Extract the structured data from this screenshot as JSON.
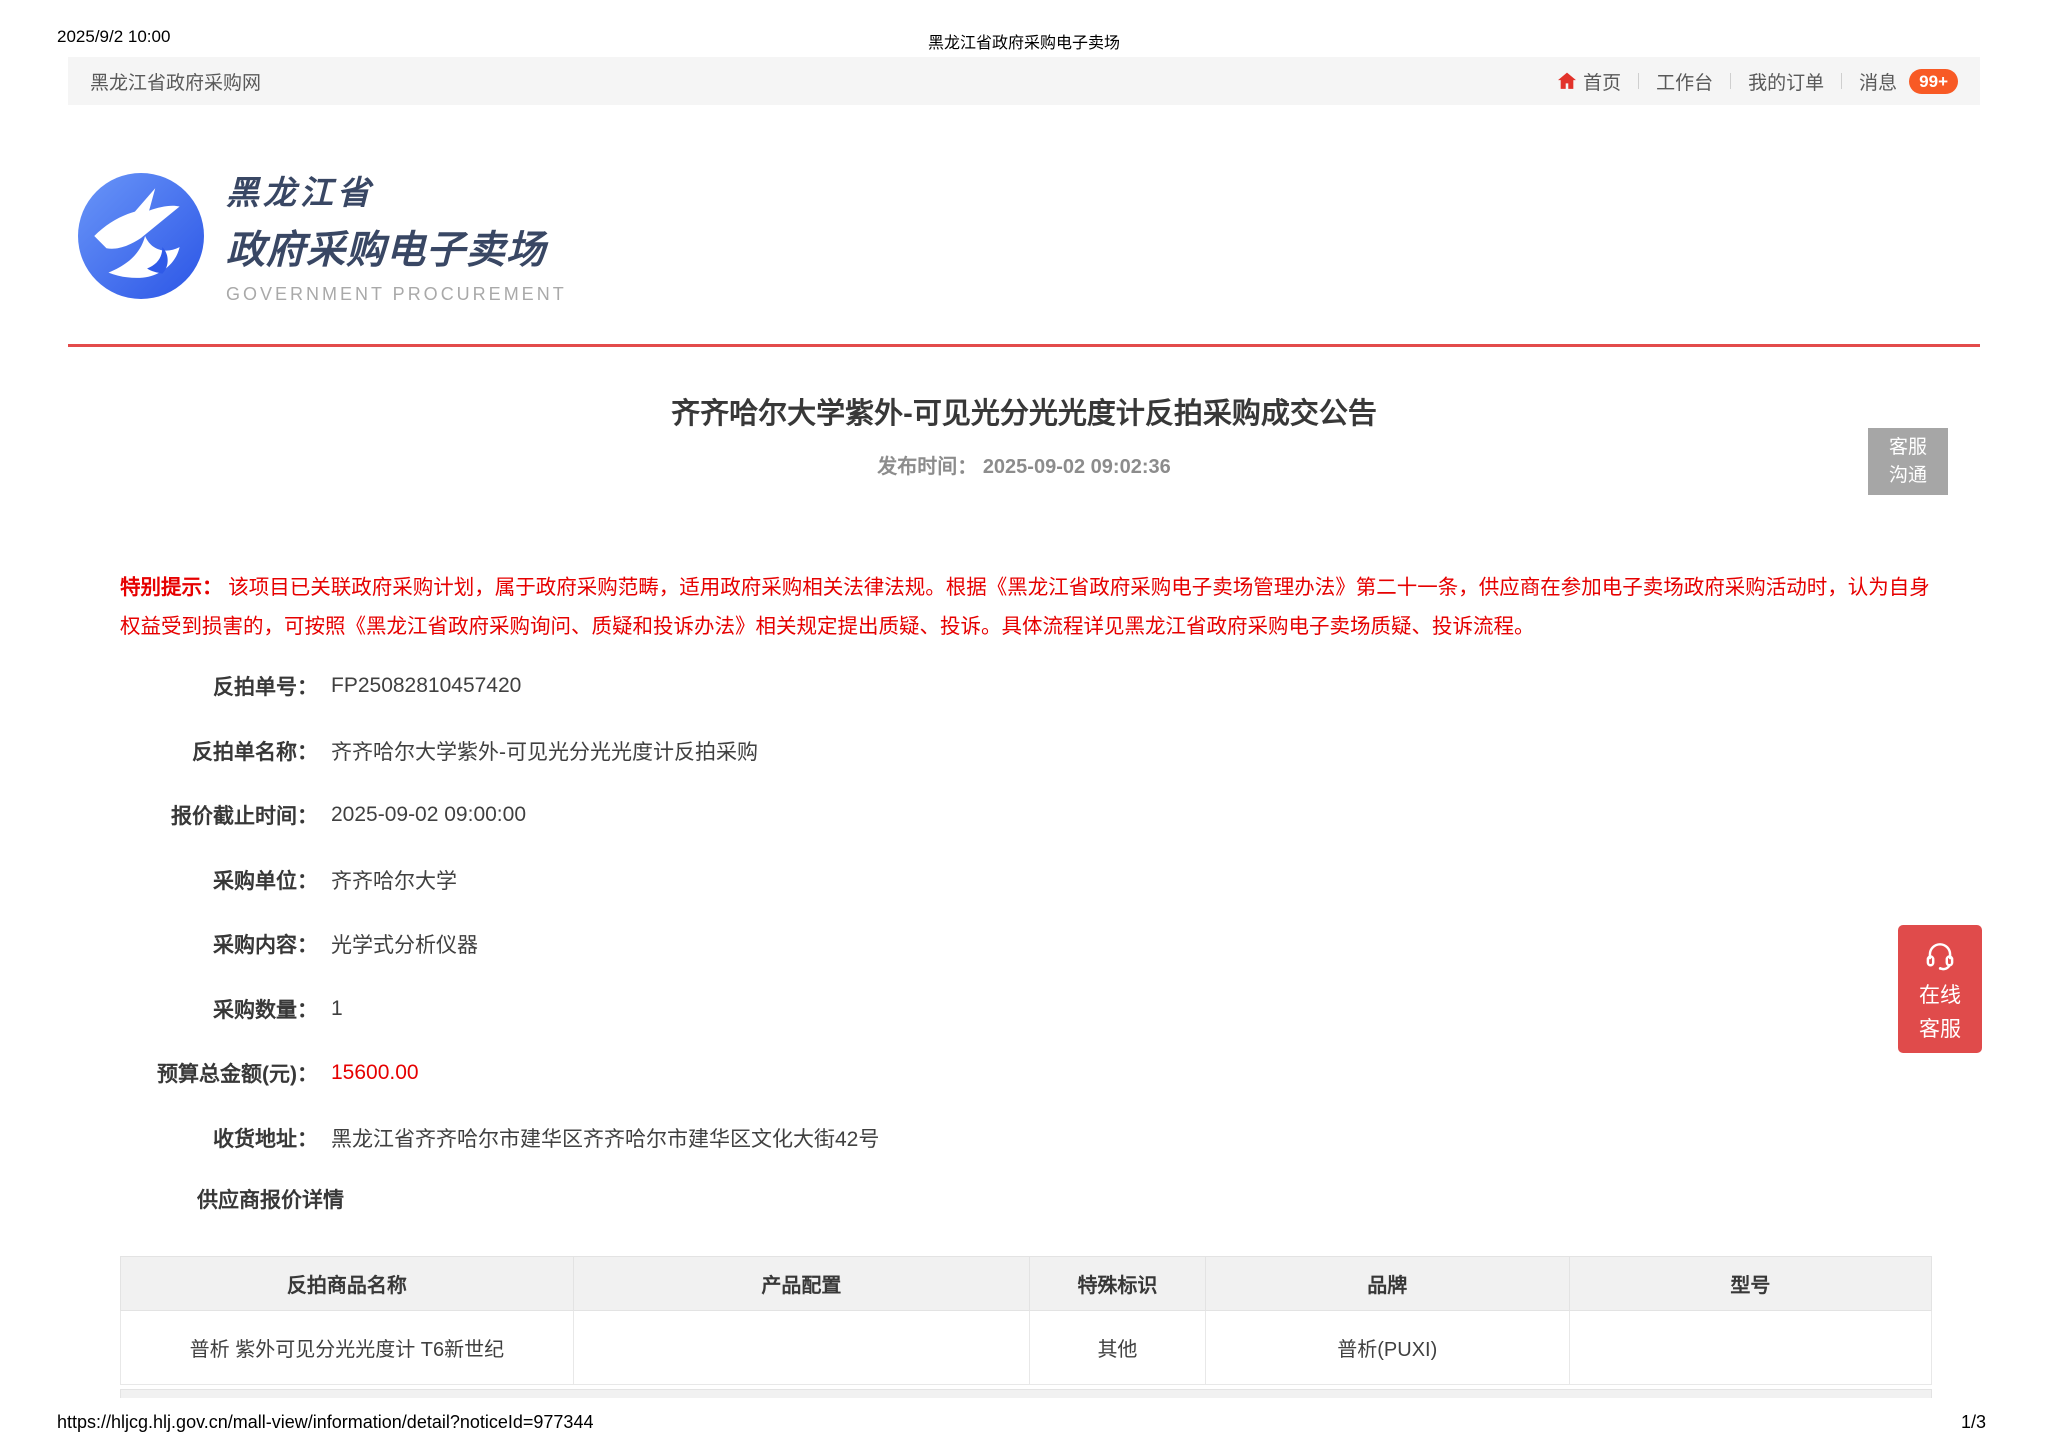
{
  "print_header": {
    "timestamp": "2025/9/2 10:00",
    "document_title": "黑龙江省政府采购电子卖场"
  },
  "navbar": {
    "site_name": "黑龙江省政府采购网",
    "items": [
      {
        "label": "首页",
        "icon": "home-icon"
      },
      {
        "label": "工作台"
      },
      {
        "label": "我的订单"
      },
      {
        "label": "消息"
      }
    ],
    "message_badge": "99+"
  },
  "logo": {
    "line1": "黑龙江省",
    "line2": "政府采购电子卖场",
    "line3": "GOVERNMENT PROCUREMENT"
  },
  "notice": {
    "title": "齐齐哈尔大学紫外-可见光分光光度计反拍采购成交公告",
    "publish_label": "发布时间：",
    "publish_time": "2025-09-02 09:02:36"
  },
  "service_chat_button": {
    "line1": "客服",
    "line2": "沟通"
  },
  "online_service_button": {
    "icon": "headset-icon",
    "line1": "在线",
    "line2": "客服"
  },
  "alert": {
    "label": "特别提示：",
    "text": "该项目已关联政府采购计划，属于政府采购范畴，适用政府采购相关法律法规。根据《黑龙江省政府采购电子卖场管理办法》第二十一条，供应商在参加电子卖场政府采购活动时，认为自身权益受到损害的，可按照《黑龙江省政府采购询问、质疑和投诉办法》相关规定提出质疑、投诉。具体流程详见黑龙江省政府采购电子卖场质疑、投诉流程。"
  },
  "fields": [
    {
      "label": "反拍单号：",
      "value": "FP25082810457420"
    },
    {
      "label": "反拍单名称：",
      "value": "齐齐哈尔大学紫外-可见光分光光度计反拍采购"
    },
    {
      "label": "报价截止时间：",
      "value": "2025-09-02 09:00:00"
    },
    {
      "label": "采购单位：",
      "value": "齐齐哈尔大学"
    },
    {
      "label": "采购内容：",
      "value": "光学式分析仪器"
    },
    {
      "label": "采购数量：",
      "value": "1"
    },
    {
      "label": "预算总金额(元)：",
      "value": "15600.00",
      "highlight": "red"
    },
    {
      "label": "收货地址：",
      "value": "黑龙江省齐齐哈尔市建华区齐齐哈尔市建华区文化大街42号"
    }
  ],
  "section_header": "供应商报价详情",
  "table": {
    "headers": [
      "反拍商品名称",
      "产品配置",
      "特殊标识",
      "品牌",
      "型号"
    ],
    "rows": [
      [
        "普析 紫外可见分光光度计 T6新世纪",
        "",
        "其他",
        "普析(PUXI)",
        ""
      ]
    ]
  },
  "footer": {
    "url": "https://hljcg.hlj.gov.cn/mall-view/information/detail?noticeId=977344",
    "page_indicator": "1/3"
  },
  "colors": {
    "accent_red": "#e34b4b",
    "alert_text_red": "#e60000",
    "budget_red": "#e60000",
    "home_icon_red": "#e2322a",
    "badge_orange": "#f85a25",
    "online_service_bg": "#e04b4b",
    "service_chat_gray": "#a6a6a6",
    "navbar_bg": "#f5f5f5",
    "table_header_bg": "#f1f1f1",
    "logo_navy": "#394764",
    "logo_blue_top": "#6a96f8",
    "logo_blue_bottom": "#2b55e6"
  }
}
